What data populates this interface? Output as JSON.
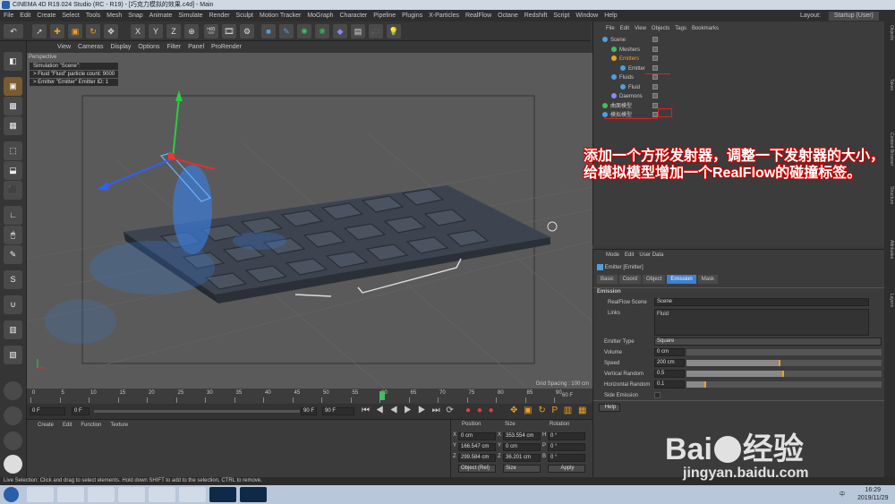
{
  "window": {
    "title": "CINEMA 4D R19.024 Studio (RC - R19) - [巧克力模拟的效果.c4d] - Main",
    "layout_label": "Layout:",
    "layout_value": "Startup (User)"
  },
  "menubar": [
    "File",
    "Edit",
    "Create",
    "Select",
    "Tools",
    "Mesh",
    "Snap",
    "Animate",
    "Simulate",
    "Render",
    "Sculpt",
    "Motion Tracker",
    "MoGraph",
    "Character",
    "Pipeline",
    "Plugins",
    "X-Particles",
    "RealFlow",
    "Octane",
    "Redshift",
    "Script",
    "Window",
    "Help"
  ],
  "viewport": {
    "menu": [
      "View",
      "Cameras",
      "Display",
      "Options",
      "Filter",
      "Panel",
      "ProRender"
    ],
    "name": "Perspective",
    "overlay": [
      "Simulation \"Scene\":",
      "> Fluid \"Fluid\" particle count: 9000",
      "> Emitter \"Emitter\" Emitter ID: 1"
    ],
    "grid_spacing": "Grid Spacing : 100 cm"
  },
  "timeline": {
    "ticks": [
      "0",
      "5",
      "10",
      "15",
      "20",
      "25",
      "30",
      "35",
      "40",
      "45",
      "50",
      "55",
      "60",
      "65",
      "70",
      "75",
      "80",
      "85",
      "90"
    ],
    "current_frame_marker": "58",
    "end_label": "60 F",
    "start_field": "0 F",
    "min_field": "0 F",
    "max_field": "90 F",
    "end_field": "90 F"
  },
  "material_manager": {
    "menu": [
      "Create",
      "Edit",
      "Function",
      "Texture"
    ]
  },
  "coordinates": {
    "headers": [
      "Position",
      "Size",
      "Rotation"
    ],
    "rows": [
      {
        "axis": "X",
        "pos": "0 cm",
        "saxis": "X",
        "size": "353.554 cm",
        "raxis": "H",
        "rot": "0 °"
      },
      {
        "axis": "Y",
        "pos": "166.547 cm",
        "saxis": "Y",
        "size": "0 cm",
        "raxis": "P",
        "rot": "0 °"
      },
      {
        "axis": "Z",
        "pos": "299.584 cm",
        "saxis": "Z",
        "size": "36.201 cm",
        "raxis": "B",
        "rot": "0 °"
      }
    ],
    "mode": "Object (Rel)",
    "size_mode": "Size",
    "apply": "Apply"
  },
  "object_manager": {
    "menu": [
      "File",
      "Edit",
      "View",
      "Objects",
      "Tags",
      "Bookmarks"
    ],
    "items": [
      {
        "label": "Scene",
        "indent": 0
      },
      {
        "label": "Meshers",
        "indent": 1
      },
      {
        "label": "Emitters",
        "indent": 1
      },
      {
        "label": "Emitter",
        "indent": 2
      },
      {
        "label": "Fluids",
        "indent": 1
      },
      {
        "label": "Fluid",
        "indent": 2
      },
      {
        "label": "Daemons",
        "indent": 1
      },
      {
        "label": "曲面模型",
        "indent": 0
      },
      {
        "label": "模拟模型",
        "indent": 0
      }
    ]
  },
  "annotation": "添加一个方形发射器，调整一下发射器的大小，给模拟模型增加一个RealFlow的碰撞标签。",
  "attributes": {
    "menu": [
      "Mode",
      "Edit",
      "User Data"
    ],
    "object_title": "Emitter [Emitter]",
    "tabs": [
      "Basic",
      "Coord",
      "Object",
      "Emission",
      "Mask"
    ],
    "active_tab": "Emission",
    "section": "Emission",
    "realflow_scene_label": "RealFlow Scene",
    "realflow_scene_value": "Scene",
    "links_label": "Links",
    "links_value": "Fluid",
    "emitter_type_label": "Emitter Type",
    "emitter_type_value": "Square",
    "volume_label": "Volume",
    "volume_value": "0 cm",
    "speed_label": "Speed",
    "speed_value": "200 cm",
    "vrandom_label": "Vertical Random",
    "vrandom_value": "0.5",
    "hrandom_label": "Horizontal Random",
    "hrandom_value": "0.1",
    "side_emission_label": "Side Emission",
    "help": "Help"
  },
  "right_strip": [
    "Objects",
    "Takes",
    "Content Browser",
    "Structure",
    "Attributes",
    "Layers"
  ],
  "status": "Live Selection: Click and drag to select elements. Hold down SHIFT to add to the selection, CTRL to remove.",
  "taskbar": {
    "time": "16:29",
    "date": "2019/11/29",
    "lang": "中"
  },
  "watermark": {
    "brand": "Bai",
    "brand2": "经验",
    "url": "jingyan.baidu.com"
  }
}
